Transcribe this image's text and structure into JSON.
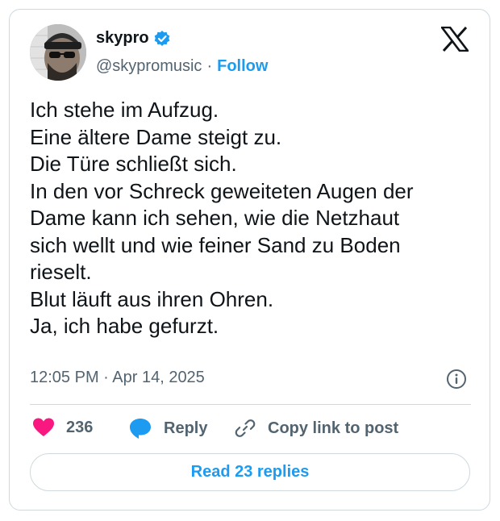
{
  "author": {
    "name": "skypro",
    "handle": "@skypromusic",
    "separator": "·",
    "follow_label": "Follow",
    "verified_icon": "verified-badge-icon"
  },
  "post": {
    "lines": [
      "Ich stehe im Aufzug.",
      "Eine ältere Dame steigt zu.",
      "Die Türe schließt sich.",
      "In den vor Schreck geweiteten Augen der",
      "Dame kann ich sehen, wie die Netzhaut",
      "sich wellt und wie feiner Sand zu Boden",
      "rieselt.",
      "Blut läuft aus ihren Ohren.",
      "Ja, ich habe gefurzt."
    ],
    "timestamp": "12:05 PM · Apr 14, 2025"
  },
  "actions": {
    "like_count": "236",
    "reply_label": "Reply",
    "copy_label": "Copy link to post"
  },
  "read_replies_label": "Read 23 replies",
  "colors": {
    "accent": "#1d9bf0",
    "like": "#f91880",
    "text": "#0f1419",
    "muted": "#536471",
    "border": "#cfd9de"
  }
}
